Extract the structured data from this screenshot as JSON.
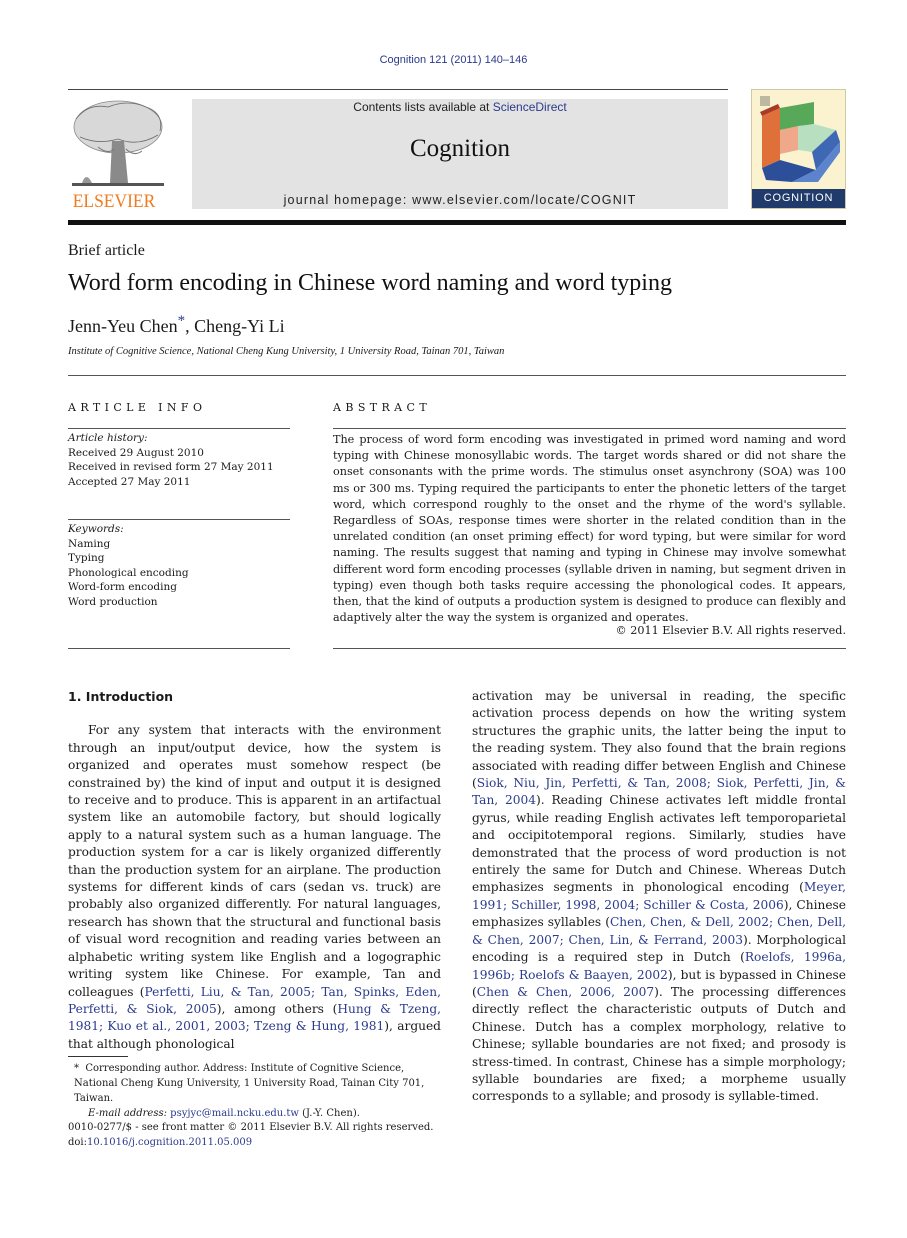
{
  "header": {
    "journal_reference": "Cognition 121 (2011) 140–146",
    "contents_prefix": "Contents lists available at ",
    "contents_link": "ScienceDirect",
    "journal_name": "Cognition",
    "homepage_line": "journal homepage: www.elsevier.com/locate/COGNIT",
    "publisher_logo_text": "ELSEVIER",
    "cover_title": "COGNITION",
    "colors": {
      "publisher_orange": "#f07b1e",
      "link_blue": "#2b3a8c",
      "band_gray": "#e3e3e3",
      "cover_navy": "#1f3a6b"
    }
  },
  "article": {
    "type": "Brief article",
    "title": "Word form encoding in Chinese word naming and word typing",
    "authors": [
      {
        "name": "Jenn-Yeu Chen",
        "marker": "*"
      },
      {
        "name": "Cheng-Yi Li",
        "marker": ""
      }
    ],
    "author_separator": ", ",
    "affiliation": "Institute of Cognitive Science, National Cheng Kung University, 1 University Road, Tainan 701, Taiwan"
  },
  "article_info": {
    "heading": "ARTICLE INFO",
    "history_label": "Article history:",
    "history": [
      "Received 29 August 2010",
      "Received in revised form 27 May 2011",
      "Accepted 27 May 2011"
    ],
    "keywords_label": "Keywords:",
    "keywords": [
      "Naming",
      "Typing",
      "Phonological encoding",
      "Word-form encoding",
      "Word production"
    ]
  },
  "abstract": {
    "heading": "ABSTRACT",
    "text": "The process of word form encoding was investigated in primed word naming and word typing with Chinese monosyllabic words. The target words shared or did not share the onset consonants with the prime words. The stimulus onset asynchrony (SOA) was 100 ms or 300 ms. Typing required the participants to enter the phonetic letters of the target word, which correspond roughly to the onset and the rhyme of the word's syllable. Regardless of SOAs, response times were shorter in the related condition than in the unrelated condition (an onset priming effect) for word typing, but were similar for word naming. The results suggest that naming and typing in Chinese may involve somewhat different word form encoding processes (syllable driven in naming, but segment driven in typing) even though both tasks require accessing the phonological codes. It appears, then, that the kind of outputs a production system is designed to produce can flexibly and adaptively alter the way the system is organized and operates.",
    "copyright": "© 2011 Elsevier B.V. All rights reserved."
  },
  "body": {
    "section_heading": "1. Introduction",
    "left_paragraph": [
      {
        "t": "For any system that interacts with the environment through an input/output device, how the system is organized and operates must somehow respect (be constrained by) the kind of input and output it is designed to receive and to produce. This is apparent in an artifactual system like an automobile factory, but should logically apply to a natural system such as a human language. The production system for a car is likely organized differently than the production system for an airplane. The production systems for different kinds of cars (sedan vs. truck) are probably also organized differently. For natural languages, research has shown that the structural and functional basis of visual word recognition and reading varies between an alphabetic writing system like English and a logographic writing system like Chinese. For example, Tan and colleagues ("
      },
      {
        "link": "Perfetti, Liu, & Tan, 2005; Tan, Spinks, Eden, Perfetti, & Siok, 2005"
      },
      {
        "t": "), among others ("
      },
      {
        "link": "Hung & Tzeng, 1981; Kuo et al., 2001, 2003; Tzeng & Hung, 1981"
      },
      {
        "t": "), argued that although phonological"
      }
    ],
    "right_paragraph": [
      {
        "t": "activation may be universal in reading, the specific activation process depends on how the writing system structures the graphic units, the latter being the input to the reading system. They also found that the brain regions associated with reading differ between English and Chinese ("
      },
      {
        "link": "Siok, Niu, Jin, Perfetti, & Tan, 2008; Siok, Perfetti, Jin, & Tan, 2004"
      },
      {
        "t": "). Reading Chinese activates left middle frontal gyrus, while reading English activates left temporoparietal and occipitotemporal regions. Similarly, studies have demonstrated that the process of word production is not entirely the same for Dutch and Chinese. Whereas Dutch emphasizes segments in phonological encoding ("
      },
      {
        "link": "Meyer, 1991; Schiller, 1998, 2004; Schiller & Costa, 2006"
      },
      {
        "t": "), Chinese emphasizes syllables ("
      },
      {
        "link": "Chen, Chen, & Dell, 2002; Chen, Dell, & Chen, 2007; Chen, Lin, & Ferrand, 2003"
      },
      {
        "t": "). Morphological encoding is a required step in Dutch ("
      },
      {
        "link": "Roelofs, 1996a, 1996b; Roelofs & Baayen, 2002"
      },
      {
        "t": "), but is bypassed in Chinese ("
      },
      {
        "link": "Chen & Chen, 2006, 2007"
      },
      {
        "t": "). The processing differences directly reflect the characteristic outputs of Dutch and Chinese. Dutch has a complex morphology, relative to Chinese; syllable boundaries are not fixed; and prosody is stress-timed. In contrast, Chinese has a simple morphology; syllable boundaries are fixed; a morpheme usually corresponds to a syllable; and prosody is syllable-timed."
      }
    ]
  },
  "footnotes": {
    "corresponding_marker": "*",
    "corresponding_text": "Corresponding author. Address: Institute of Cognitive Science, National Cheng Kung University, 1 University Road, Tainan City 701, Taiwan.",
    "email_label": "E-mail address:",
    "email": "psyjyc@mail.ncku.edu.tw",
    "email_suffix": " (J.-Y. Chen).",
    "front_matter": "0010-0277/$ - see front matter © 2011 Elsevier B.V. All rights reserved.",
    "doi_prefix": "doi:",
    "doi": "10.1016/j.cognition.2011.05.009"
  }
}
